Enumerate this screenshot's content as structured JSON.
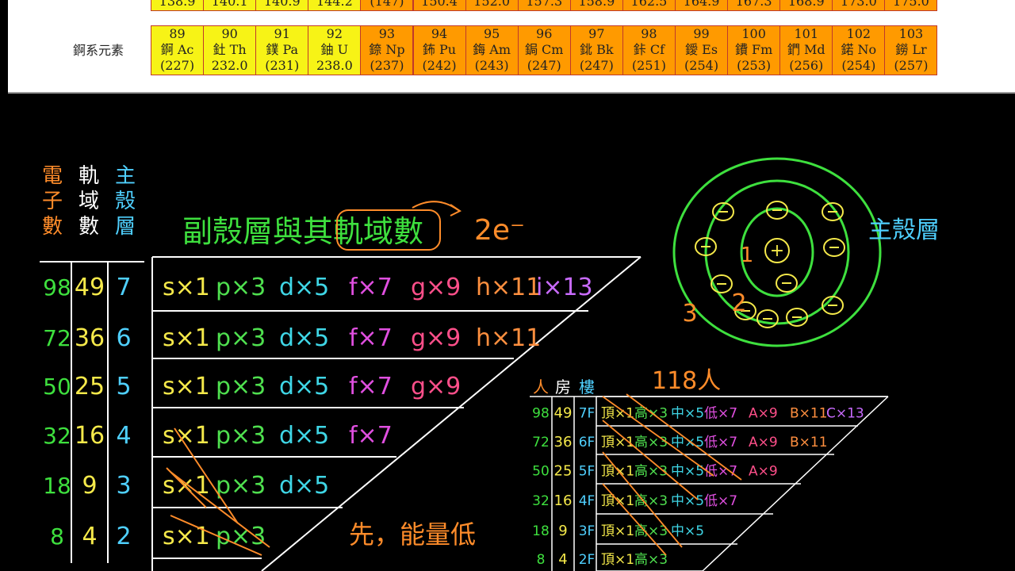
{
  "top_row_values": [
    "138.9",
    "140.1",
    "140.9",
    "144.2",
    "(147)",
    "150.4",
    "152.0",
    "157.3",
    "158.9",
    "162.5",
    "164.9",
    "167.3",
    "168.9",
    "173.0",
    "175.0"
  ],
  "series_label": "錒系元素",
  "actinides": [
    {
      "n": "89",
      "sym": "錒 Ac",
      "m": "(227)",
      "c": "y"
    },
    {
      "n": "90",
      "sym": "釷 Th",
      "m": "232.0",
      "c": "y"
    },
    {
      "n": "91",
      "sym": "鏷 Pa",
      "m": "(231)",
      "c": "y"
    },
    {
      "n": "92",
      "sym": "鈾 U",
      "m": "238.0",
      "c": "y"
    },
    {
      "n": "93",
      "sym": "錼 Np",
      "m": "(237)",
      "c": "o"
    },
    {
      "n": "94",
      "sym": "鈽 Pu",
      "m": "(242)",
      "c": "o"
    },
    {
      "n": "95",
      "sym": "鋂 Am",
      "m": "(243)",
      "c": "o"
    },
    {
      "n": "96",
      "sym": "鋦 Cm",
      "m": "(247)",
      "c": "o"
    },
    {
      "n": "97",
      "sym": "鉳 Bk",
      "m": "(247)",
      "c": "o"
    },
    {
      "n": "98",
      "sym": "鉲 Cf",
      "m": "(251)",
      "c": "o"
    },
    {
      "n": "99",
      "sym": "鑀 Es",
      "m": "(254)",
      "c": "o"
    },
    {
      "n": "100",
      "sym": "鐨 Fm",
      "m": "(253)",
      "c": "o"
    },
    {
      "n": "101",
      "sym": "鍆 Md",
      "m": "(256)",
      "c": "o"
    },
    {
      "n": "102",
      "sym": "鍩 No",
      "m": "(254)",
      "c": "o"
    },
    {
      "n": "103",
      "sym": "鐒 Lr",
      "m": "(257)",
      "c": "o"
    }
  ],
  "board": {
    "title": "副殼層與其軌域數",
    "two_e": "2e⁻",
    "col_headers": [
      "電子數",
      "軌域數",
      "主殼層"
    ],
    "rows": [
      {
        "e": "98",
        "orb": "49",
        "shell": "7",
        "items": [
          "s×1",
          "p×3",
          "d×5",
          "f×7",
          "g×9",
          "h×11",
          "i×13"
        ]
      },
      {
        "e": "72",
        "orb": "36",
        "shell": "6",
        "items": [
          "s×1",
          "p×3",
          "d×5",
          "f×7",
          "g×9",
          "h×11"
        ]
      },
      {
        "e": "50",
        "orb": "25",
        "shell": "5",
        "items": [
          "s×1",
          "p×3",
          "d×5",
          "f×7",
          "g×9"
        ]
      },
      {
        "e": "32",
        "orb": "16",
        "shell": "4",
        "items": [
          "s×1",
          "p×3",
          "d×5",
          "f×7"
        ]
      },
      {
        "e": "18",
        "orb": "9",
        "shell": "3",
        "items": [
          "s×1",
          "p×3",
          "d×5"
        ]
      },
      {
        "e": "8",
        "orb": "4",
        "shell": "2",
        "items": [
          "s×1",
          "p×3"
        ]
      }
    ],
    "note": "先，能量低",
    "atom_label": "主殼層",
    "atom_nums": [
      "1",
      "2",
      "3"
    ],
    "building_title": "118人",
    "building_headers": [
      "人",
      "房",
      "樓"
    ],
    "building_rows": [
      {
        "p": "98",
        "r": "49",
        "f": "7F",
        "items": [
          "頂×1",
          "高×3",
          "中×5",
          "低×7",
          "A×9",
          "B×11",
          "C×13"
        ]
      },
      {
        "p": "72",
        "r": "36",
        "f": "6F",
        "items": [
          "頂×1",
          "高×3",
          "中×5",
          "低×7",
          "A×9",
          "B×11"
        ]
      },
      {
        "p": "50",
        "r": "25",
        "f": "5F",
        "items": [
          "頂×1",
          "高×3",
          "中×5",
          "低×7",
          "A×9"
        ]
      },
      {
        "p": "32",
        "r": "16",
        "f": "4F",
        "items": [
          "頂×1",
          "高×3",
          "中×5",
          "低×7"
        ]
      },
      {
        "p": "18",
        "r": "9",
        "f": "3F",
        "items": [
          "頂×1",
          "高×3",
          "中×5"
        ]
      },
      {
        "p": "8",
        "r": "4",
        "f": "2F",
        "items": [
          "頂×1",
          "高×3"
        ]
      }
    ],
    "colors": {
      "s": "#f5e94a",
      "p": "#4fe04f",
      "d": "#3fd6e6",
      "f": "#e04fe0",
      "g": "#ff4f8a",
      "h": "#ff8f3f",
      "i": "#c96bff",
      "green": "#3ee03e",
      "cyan": "#4fd0ff",
      "orange": "#ff8c2a",
      "yellow": "#f5e94a",
      "white": "#ffffff"
    }
  }
}
